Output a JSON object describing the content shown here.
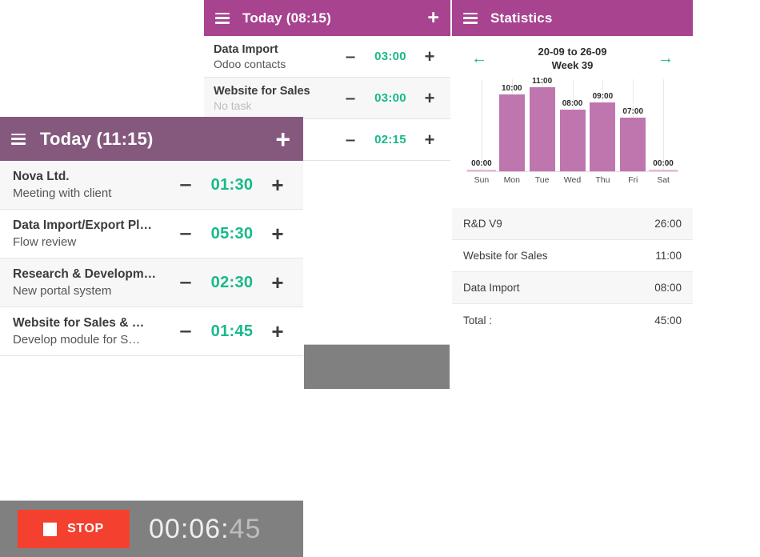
{
  "left_panel": {
    "appbar": {
      "menu_icon": "hamburger-icon",
      "title": "Today (11:15)",
      "add_icon": "plus-icon",
      "add_label": "+",
      "menu_label": "≡"
    },
    "rows": [
      {
        "title": "Nova Ltd.",
        "subtitle": "Meeting with client",
        "minus": "‒",
        "time": "01:30",
        "plus": "+"
      },
      {
        "title": "Data Import/Export Pl…",
        "subtitle": "Flow review",
        "minus": "‒",
        "time": "05:30",
        "plus": "+"
      },
      {
        "title": "Research & Developm…",
        "subtitle": "New portal system",
        "minus": "‒",
        "time": "02:30",
        "plus": "+"
      },
      {
        "title": "Website for Sales & …",
        "subtitle": "Develop module for S…",
        "minus": "‒",
        "time": "01:45",
        "plus": "+"
      }
    ],
    "stop_bar": {
      "stop_label": "STOP",
      "timer_main": "00:06:",
      "timer_seconds": "45",
      "stop_icon": "stop-square-icon"
    }
  },
  "mid_panel": {
    "appbar": {
      "menu_label": "≡",
      "title": "Today (08:15)",
      "add_label": "+"
    },
    "rows": [
      {
        "title": "Data Import",
        "subtitle": "Odoo contacts",
        "minus": "‒",
        "time": "03:00",
        "plus": "+"
      },
      {
        "title": "Website for Sales",
        "subtitle": "No task",
        "minus": "‒",
        "time": "03:00",
        "plus": "+"
      },
      {
        "title": "",
        "subtitle": "",
        "minus": "‒",
        "time": "02:15",
        "plus": "+"
      }
    ]
  },
  "stats_panel": {
    "appbar": {
      "menu_label": "≡",
      "title": "Statistics"
    },
    "week_nav": {
      "prev_label": "←",
      "next_label": "→",
      "range": "20-09 to 26-09",
      "week": "Week 39"
    },
    "summary": [
      {
        "name": "R&D V9",
        "value": "26:00"
      },
      {
        "name": "Website for Sales",
        "value": "11:00"
      },
      {
        "name": "Data Import",
        "value": "08:00"
      },
      {
        "name": "Total :",
        "value": "45:00"
      }
    ]
  },
  "colors": {
    "appbar_bright": "#a8438f",
    "appbar_muted": "#85597e",
    "time_green": "#17b98b",
    "bar_fill": "#bf75ae",
    "stop_red": "#f4402f",
    "bottom_bar_gray": "#808080"
  },
  "chart_data": {
    "type": "bar",
    "title": "20-09 to 26-09 Week 39",
    "categories": [
      "Sun",
      "Mon",
      "Tue",
      "Wed",
      "Thu",
      "Fri",
      "Sat"
    ],
    "values": [
      0,
      10,
      11,
      8,
      9,
      7,
      0
    ],
    "value_labels": [
      "00:00",
      "10:00",
      "11:00",
      "08:00",
      "09:00",
      "07:00",
      "00:00"
    ],
    "xlabel": "",
    "ylabel": "",
    "ylim": [
      0,
      12
    ],
    "grid": true,
    "legend": "none",
    "color": "#bf75ae"
  }
}
